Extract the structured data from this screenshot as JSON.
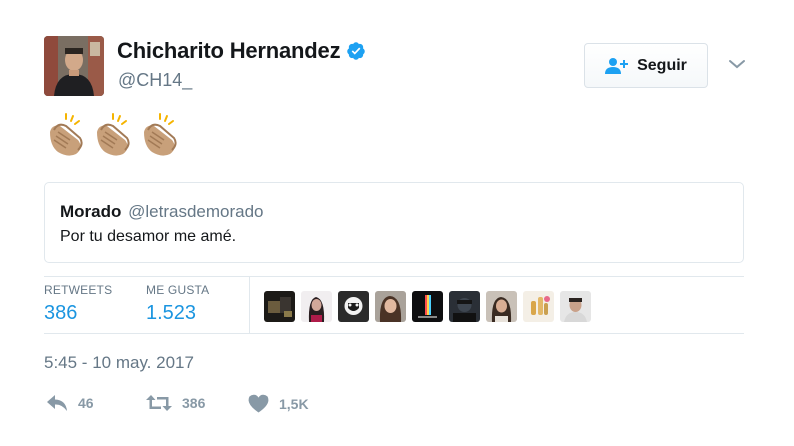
{
  "author": {
    "name": "Chicharito Hernandez",
    "handle": "@CH14_",
    "verified": true,
    "avatar_icon": "avatar-photo"
  },
  "follow_button": {
    "label": "Seguir",
    "icon": "add-user-icon"
  },
  "tweet": {
    "emoji": [
      "👏🏽",
      "👏🏽",
      "👏🏽"
    ]
  },
  "quoted_tweet": {
    "name": "Morado",
    "handle": "@letrasdemorado",
    "text": "Por tu desamor me amé."
  },
  "stats": {
    "retweets_label": "RETWEETS",
    "retweets_value": "386",
    "likes_label": "ME GUSTA",
    "likes_value": "1.523"
  },
  "likers": [
    "liker-1",
    "liker-2",
    "liker-3",
    "liker-4",
    "liker-5",
    "liker-6",
    "liker-7",
    "liker-8",
    "liker-9"
  ],
  "timestamp": "5:45 - 10 may. 2017",
  "actions": {
    "reply_count": "46",
    "retweet_count": "386",
    "like_count": "1,5K"
  },
  "colors": {
    "accent": "#1b95e0",
    "verified": "#1da1f2",
    "muted": "#657786",
    "action": "#8899a6"
  }
}
